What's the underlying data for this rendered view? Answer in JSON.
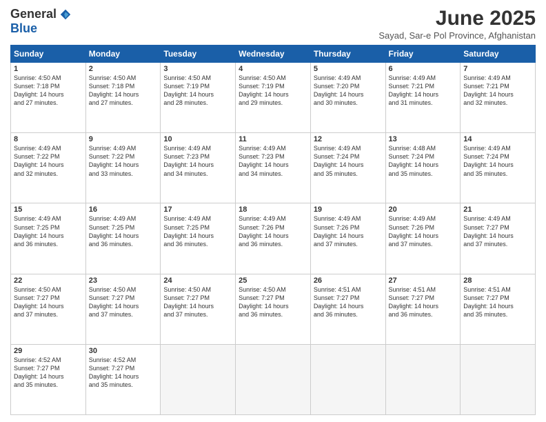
{
  "logo": {
    "general": "General",
    "blue": "Blue"
  },
  "title": "June 2025",
  "subtitle": "Sayad, Sar-e Pol Province, Afghanistan",
  "headers": [
    "Sunday",
    "Monday",
    "Tuesday",
    "Wednesday",
    "Thursday",
    "Friday",
    "Saturday"
  ],
  "weeks": [
    [
      {
        "day": "1",
        "sunrise": "4:50 AM",
        "sunset": "7:18 PM",
        "daylight": "14 hours and 27 minutes."
      },
      {
        "day": "2",
        "sunrise": "4:50 AM",
        "sunset": "7:18 PM",
        "daylight": "14 hours and 27 minutes."
      },
      {
        "day": "3",
        "sunrise": "4:50 AM",
        "sunset": "7:19 PM",
        "daylight": "14 hours and 28 minutes."
      },
      {
        "day": "4",
        "sunrise": "4:50 AM",
        "sunset": "7:19 PM",
        "daylight": "14 hours and 29 minutes."
      },
      {
        "day": "5",
        "sunrise": "4:49 AM",
        "sunset": "7:20 PM",
        "daylight": "14 hours and 30 minutes."
      },
      {
        "day": "6",
        "sunrise": "4:49 AM",
        "sunset": "7:21 PM",
        "daylight": "14 hours and 31 minutes."
      },
      {
        "day": "7",
        "sunrise": "4:49 AM",
        "sunset": "7:21 PM",
        "daylight": "14 hours and 32 minutes."
      }
    ],
    [
      {
        "day": "8",
        "sunrise": "4:49 AM",
        "sunset": "7:22 PM",
        "daylight": "14 hours and 32 minutes."
      },
      {
        "day": "9",
        "sunrise": "4:49 AM",
        "sunset": "7:22 PM",
        "daylight": "14 hours and 33 minutes."
      },
      {
        "day": "10",
        "sunrise": "4:49 AM",
        "sunset": "7:23 PM",
        "daylight": "14 hours and 34 minutes."
      },
      {
        "day": "11",
        "sunrise": "4:49 AM",
        "sunset": "7:23 PM",
        "daylight": "14 hours and 34 minutes."
      },
      {
        "day": "12",
        "sunrise": "4:49 AM",
        "sunset": "7:24 PM",
        "daylight": "14 hours and 35 minutes."
      },
      {
        "day": "13",
        "sunrise": "4:48 AM",
        "sunset": "7:24 PM",
        "daylight": "14 hours and 35 minutes."
      },
      {
        "day": "14",
        "sunrise": "4:49 AM",
        "sunset": "7:24 PM",
        "daylight": "14 hours and 35 minutes."
      }
    ],
    [
      {
        "day": "15",
        "sunrise": "4:49 AM",
        "sunset": "7:25 PM",
        "daylight": "14 hours and 36 minutes."
      },
      {
        "day": "16",
        "sunrise": "4:49 AM",
        "sunset": "7:25 PM",
        "daylight": "14 hours and 36 minutes."
      },
      {
        "day": "17",
        "sunrise": "4:49 AM",
        "sunset": "7:25 PM",
        "daylight": "14 hours and 36 minutes."
      },
      {
        "day": "18",
        "sunrise": "4:49 AM",
        "sunset": "7:26 PM",
        "daylight": "14 hours and 36 minutes."
      },
      {
        "day": "19",
        "sunrise": "4:49 AM",
        "sunset": "7:26 PM",
        "daylight": "14 hours and 37 minutes."
      },
      {
        "day": "20",
        "sunrise": "4:49 AM",
        "sunset": "7:26 PM",
        "daylight": "14 hours and 37 minutes."
      },
      {
        "day": "21",
        "sunrise": "4:49 AM",
        "sunset": "7:27 PM",
        "daylight": "14 hours and 37 minutes."
      }
    ],
    [
      {
        "day": "22",
        "sunrise": "4:50 AM",
        "sunset": "7:27 PM",
        "daylight": "14 hours and 37 minutes."
      },
      {
        "day": "23",
        "sunrise": "4:50 AM",
        "sunset": "7:27 PM",
        "daylight": "14 hours and 37 minutes."
      },
      {
        "day": "24",
        "sunrise": "4:50 AM",
        "sunset": "7:27 PM",
        "daylight": "14 hours and 37 minutes."
      },
      {
        "day": "25",
        "sunrise": "4:50 AM",
        "sunset": "7:27 PM",
        "daylight": "14 hours and 36 minutes."
      },
      {
        "day": "26",
        "sunrise": "4:51 AM",
        "sunset": "7:27 PM",
        "daylight": "14 hours and 36 minutes."
      },
      {
        "day": "27",
        "sunrise": "4:51 AM",
        "sunset": "7:27 PM",
        "daylight": "14 hours and 36 minutes."
      },
      {
        "day": "28",
        "sunrise": "4:51 AM",
        "sunset": "7:27 PM",
        "daylight": "14 hours and 35 minutes."
      }
    ],
    [
      {
        "day": "29",
        "sunrise": "4:52 AM",
        "sunset": "7:27 PM",
        "daylight": "14 hours and 35 minutes."
      },
      {
        "day": "30",
        "sunrise": "4:52 AM",
        "sunset": "7:27 PM",
        "daylight": "14 hours and 35 minutes."
      },
      null,
      null,
      null,
      null,
      null
    ]
  ]
}
